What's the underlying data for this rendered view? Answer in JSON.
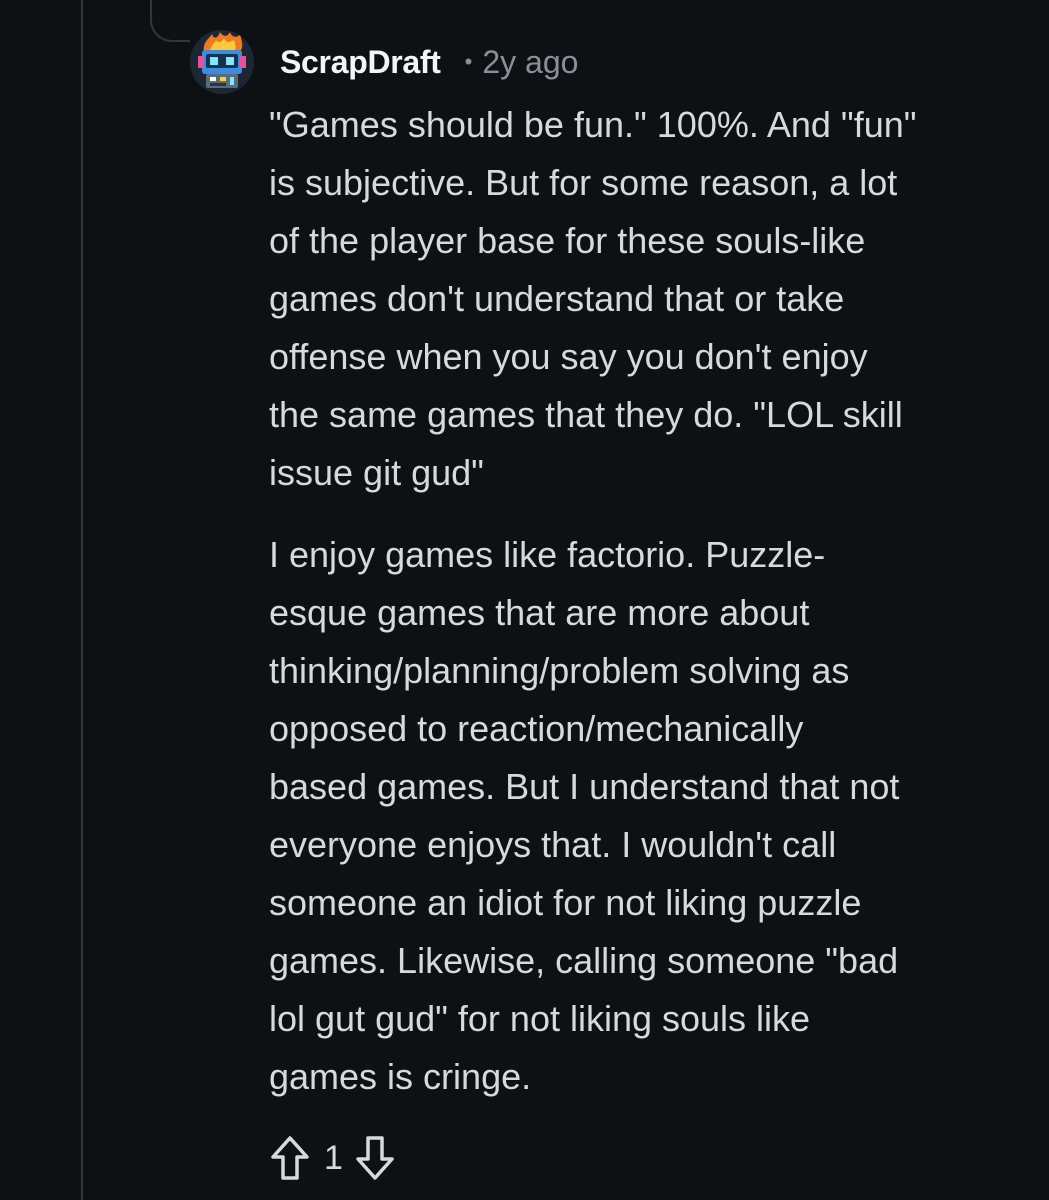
{
  "comment": {
    "username": "ScrapDraft",
    "separator": "•",
    "timestamp": "2y ago",
    "avatar_icon": "robot-avatar-icon",
    "paragraph_one_lines": [
      "\"Games should be fun.\" 100%. And \"fun\"",
      "is subjective. But for some reason, a lot",
      "of the player base for these souls-like",
      "games don't understand that or take",
      "offense when you say you don't enjoy",
      "the same games that they do. \"LOL skill",
      "issue git gud\""
    ],
    "paragraph_two_lines": [
      "I enjoy games like factorio. Puzzle-",
      "esque games that are more about",
      "thinking/planning/problem solving as",
      "opposed to reaction/mechanically",
      "based games. But I understand that not",
      "everyone enjoys that. I wouldn't call",
      "someone an idiot for not liking puzzle",
      "games. Likewise, calling someone \"bad",
      "lol gut gud\" for not liking souls like",
      "games is cringe."
    ],
    "vote_count": "1",
    "upvote_icon": "upvote-arrow-icon",
    "downvote_icon": "downvote-arrow-icon"
  },
  "colors": {
    "background": "#0e1113",
    "text": "#d7dadc",
    "meta": "#8a9094",
    "thread_line": "#343638"
  }
}
